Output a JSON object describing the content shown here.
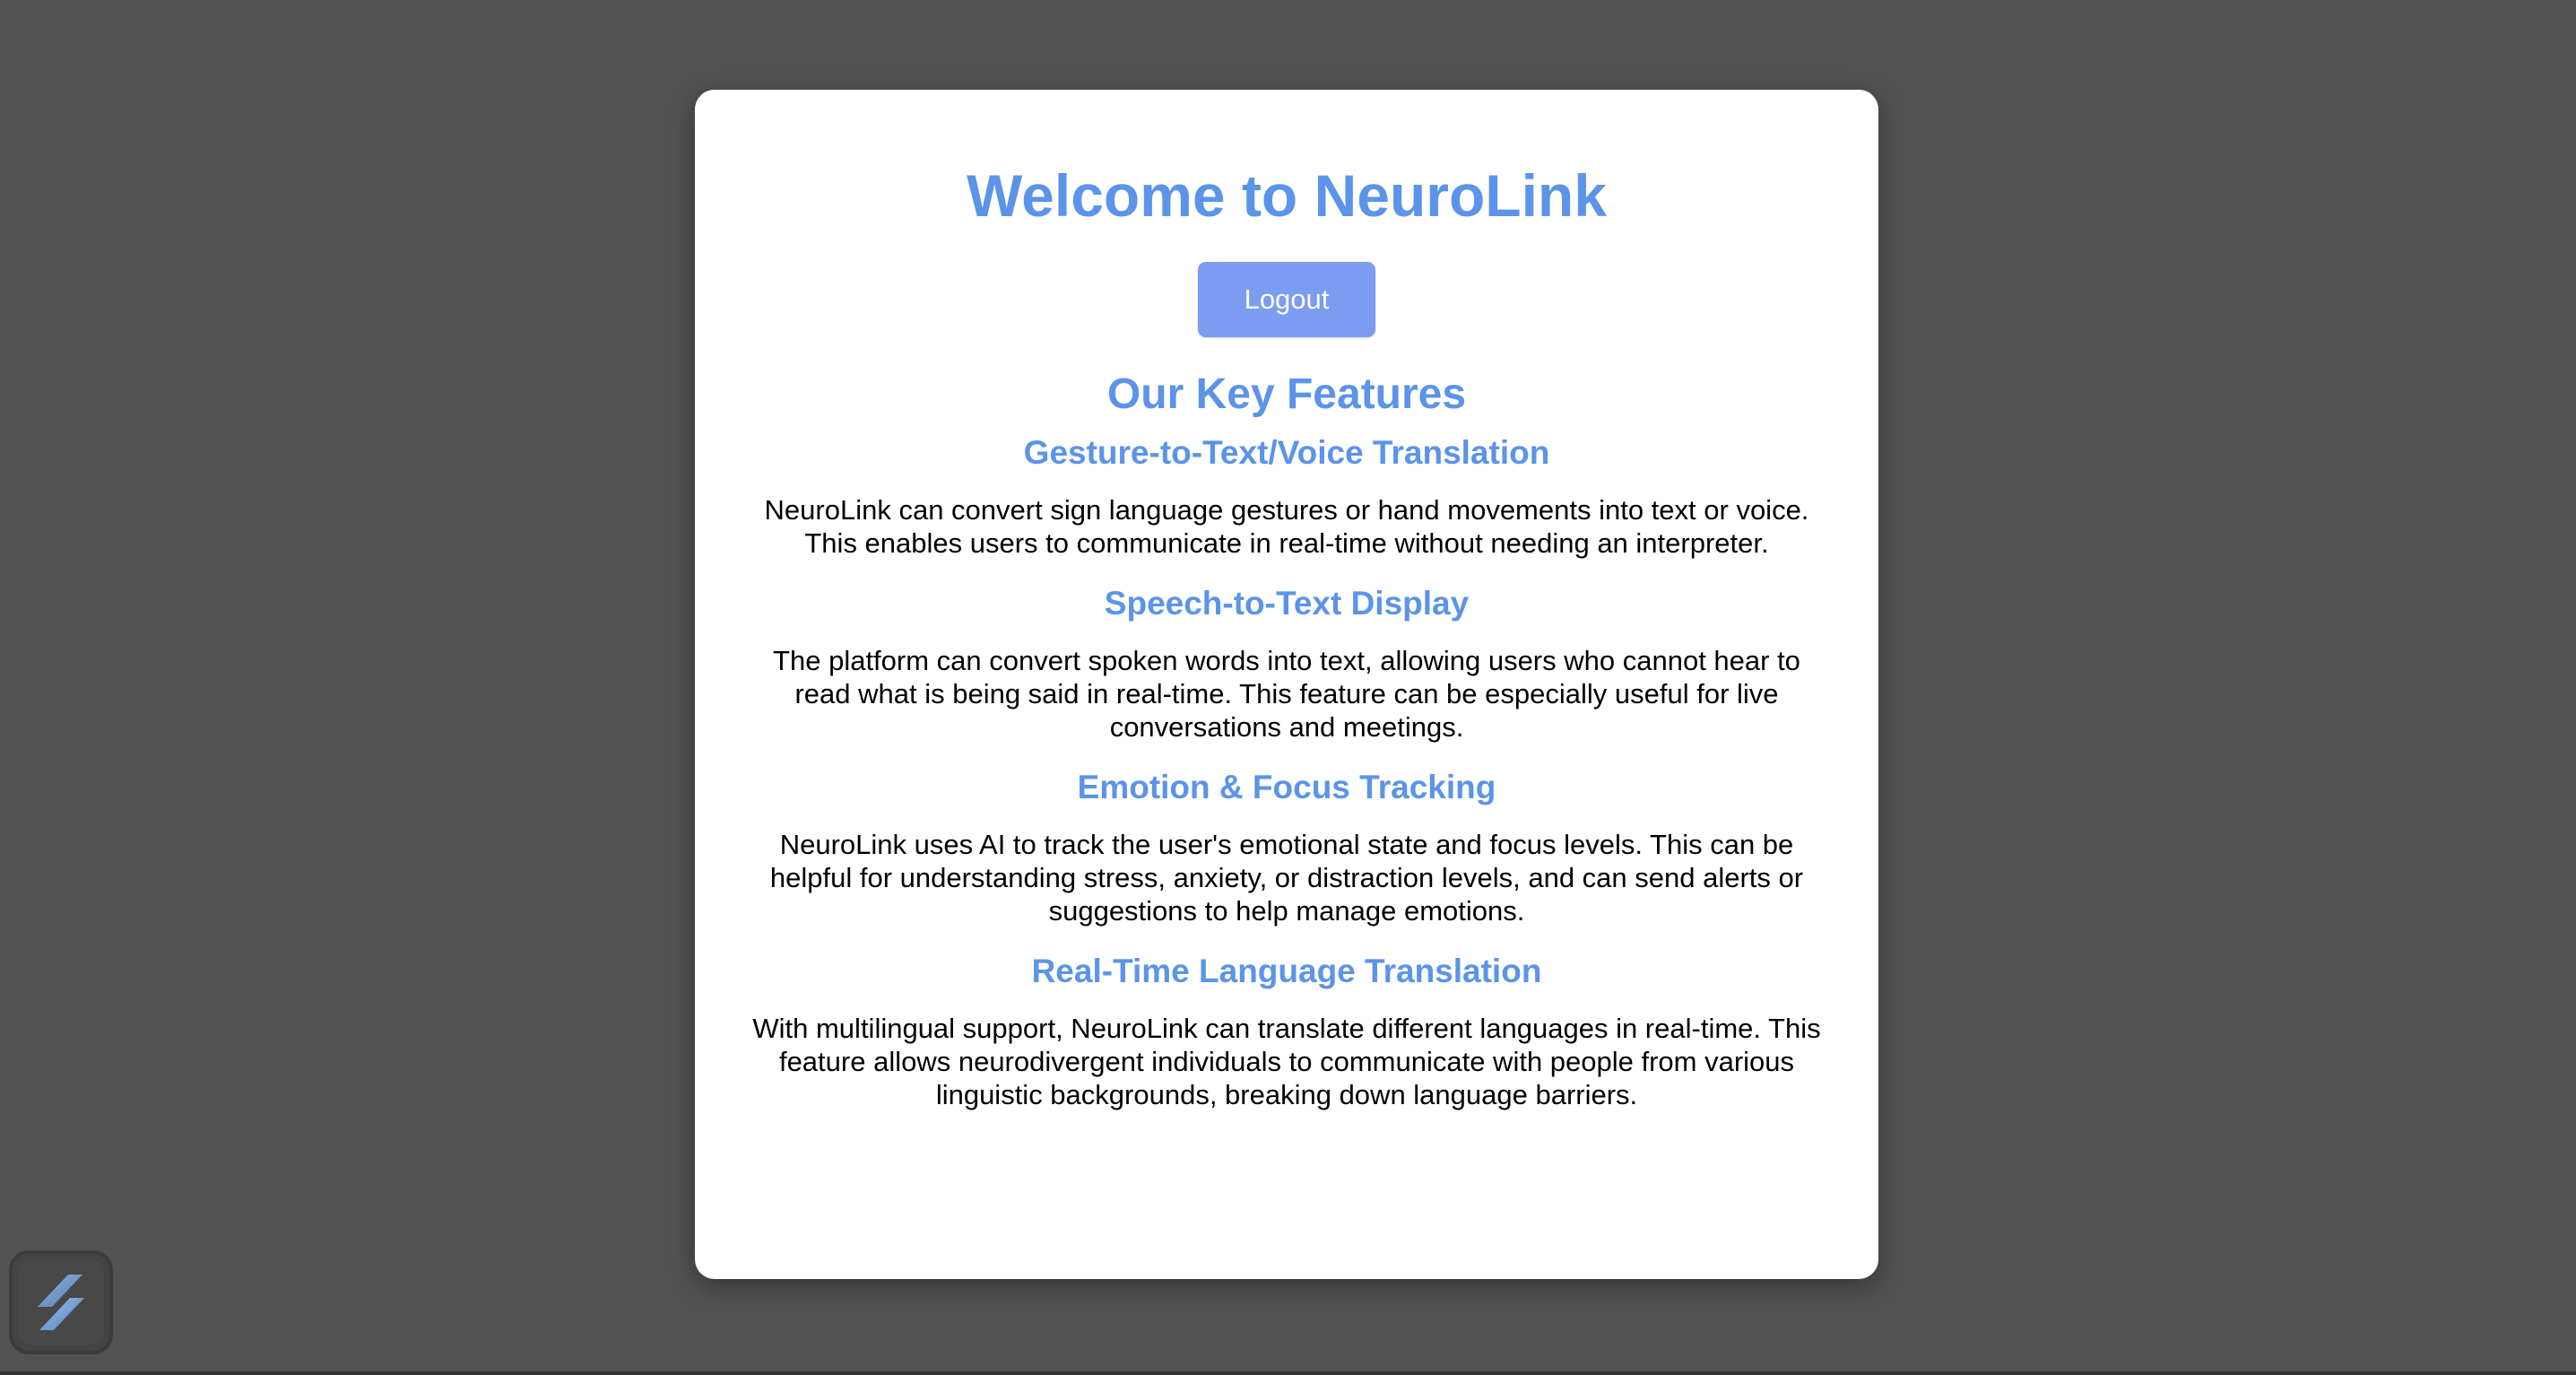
{
  "header": {
    "title": "Welcome to NeuroLink",
    "logout_label": "Logout"
  },
  "features": {
    "heading": "Our Key Features",
    "items": [
      {
        "title": "Gesture-to-Text/Voice Translation",
        "description": "NeuroLink can convert sign language gestures or hand movements into text or voice. This enables users to communicate in real-time without needing an interpreter."
      },
      {
        "title": "Speech-to-Text Display",
        "description": "The platform can convert spoken words into text, allowing users who cannot hear to read what is being said in real-time. This feature can be especially useful for live conversations and meetings."
      },
      {
        "title": "Emotion & Focus Tracking",
        "description": "NeuroLink uses AI to track the user's emotional state and focus levels. This can be helpful for understanding stress, anxiety, or distraction levels, and can send alerts or suggestions to help manage emotions."
      },
      {
        "title": "Real-Time Language Translation",
        "description": "With multilingual support, NeuroLink can translate different languages in real-time. This feature allows neurodivergent individuals to communicate with people from various linguistic backgrounds, breaking down language barriers."
      }
    ]
  },
  "launcher": {
    "icon": "app-logo-icon"
  },
  "colors": {
    "background": "#525252",
    "card": "#ffffff",
    "accent_text": "#5b94e8",
    "button": "#7b9cf1"
  }
}
